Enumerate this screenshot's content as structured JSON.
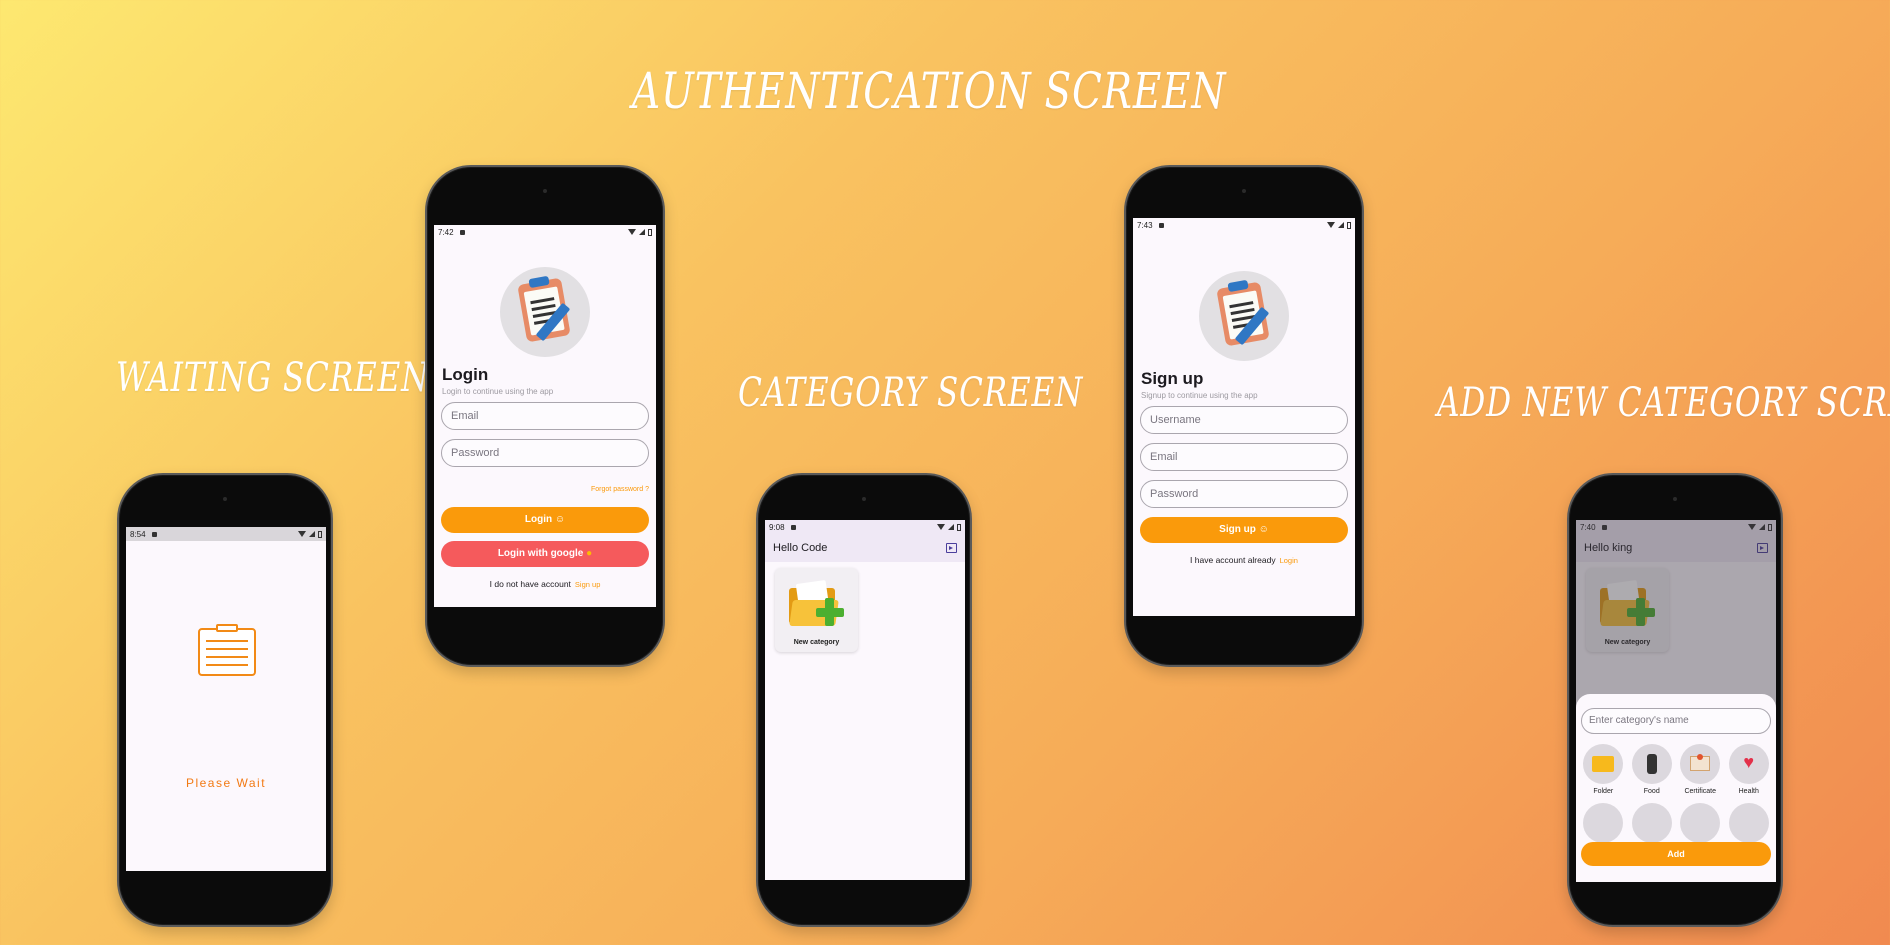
{
  "headings": {
    "authentication": "AUTHENTICATION SCREEN",
    "waiting": "WAITING SCREEN",
    "category": "CATEGORY SCREEN",
    "add_category": "ADD NEW CATEGORY SCREEN"
  },
  "waiting_screen": {
    "status_time": "8:54",
    "message": "Please Wait"
  },
  "login_screen": {
    "status_time": "7:42",
    "title": "Login",
    "subtitle": "Login to continue using the app",
    "email_placeholder": "Email",
    "password_placeholder": "Password",
    "forgot_password": "Forgot password ?",
    "login_button": "Login",
    "google_button": "Login with google",
    "no_account_text": "I do not have account",
    "signup_link": "Sign up"
  },
  "category_screen": {
    "status_time": "9:08",
    "appbar_title": "Hello Code",
    "new_category_label": "New category"
  },
  "signup_screen": {
    "status_time": "7:43",
    "title": "Sign up",
    "subtitle": "Signup to continue using the app",
    "username_placeholder": "Username",
    "email_placeholder": "Email",
    "password_placeholder": "Password",
    "signup_button": "Sign up",
    "have_account_text": "I have account already",
    "login_link": "Login"
  },
  "add_category_screen": {
    "status_time": "7:40",
    "appbar_title": "Hello king",
    "new_category_label": "New category",
    "name_placeholder": "Enter category's name",
    "icons": [
      {
        "label": "Folder",
        "icon": "folder-icon"
      },
      {
        "label": "Food",
        "icon": "food-icon"
      },
      {
        "label": "Certificate",
        "icon": "certificate-icon"
      },
      {
        "label": "Health",
        "icon": "health-icon"
      }
    ],
    "add_button": "Add"
  },
  "colors": {
    "accent_orange": "#fa9a0b",
    "google_red": "#f55a5c",
    "appbar_purple": "#efe8f5",
    "screen_bg": "#fcf8fd"
  }
}
